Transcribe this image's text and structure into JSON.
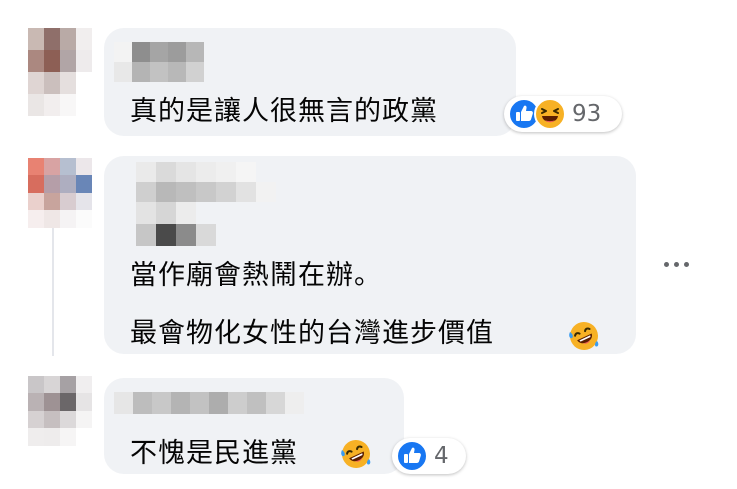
{
  "comments": [
    {
      "text": "真的是讓人很無言的政黨",
      "reactions": {
        "icons": [
          "like-icon",
          "haha-icon"
        ],
        "count": "93"
      }
    },
    {
      "lines": [
        "當作廟會熱鬧在辦。",
        "最會物化女性的台灣進步價值"
      ],
      "inline_emoji": "laughing-crying-emoji"
    },
    {
      "text": "不愧是民進黨",
      "inline_emoji": "laughing-crying-emoji",
      "reactions": {
        "icons": [
          "like-icon"
        ],
        "count": "4"
      }
    }
  ],
  "colors": {
    "bubble": "#f0f2f5",
    "like_blue": "#1877f2",
    "haha_yellow": "#f7b125",
    "text": "#050505",
    "meta": "#65676b"
  }
}
